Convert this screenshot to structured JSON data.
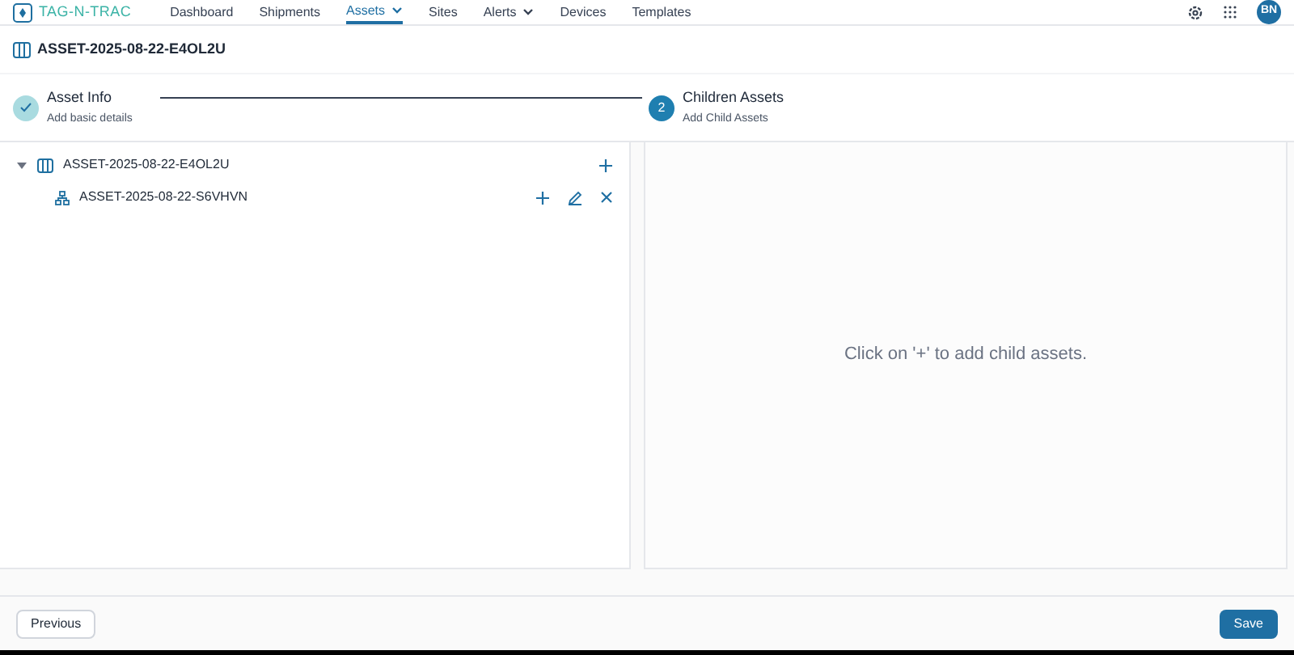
{
  "nav": {
    "logo": "TAG-N-TRAC",
    "items": [
      {
        "label": "Dashboard",
        "selected": false,
        "dropdown": false
      },
      {
        "label": "Shipments",
        "selected": false,
        "dropdown": false
      },
      {
        "label": "Assets",
        "selected": true,
        "dropdown": true
      },
      {
        "label": "Sites",
        "selected": false,
        "dropdown": false
      },
      {
        "label": "Alerts",
        "selected": false,
        "dropdown": true
      },
      {
        "label": "Devices",
        "selected": false,
        "dropdown": false
      },
      {
        "label": "Templates",
        "selected": false,
        "dropdown": false
      }
    ],
    "avatar": "BN"
  },
  "page_title": "ASSET-2025-08-22-E4OL2U",
  "steps": [
    {
      "title": "Asset Info",
      "subtitle": "Add basic details",
      "completed": true
    },
    {
      "number": "2",
      "title": "Children Assets",
      "subtitle": "Add Child Assets",
      "completed": false
    }
  ],
  "tree": [
    {
      "label": "ASSET-2025-08-22-E4OL2U",
      "expanded": true,
      "children": [
        {
          "label": "ASSET-2025-08-22-S6VHVN"
        }
      ]
    }
  ],
  "empty_message": "Click on '+' to add child assets.",
  "footer": {
    "previous": "Previous",
    "save": "Save"
  }
}
